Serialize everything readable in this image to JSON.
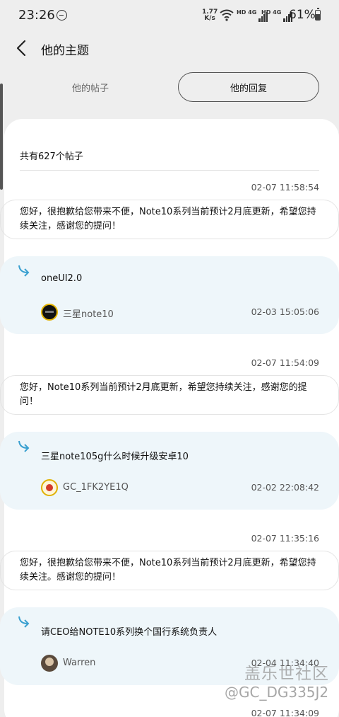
{
  "status_bar": {
    "time": "23:26",
    "net_speed_value": "1.77",
    "net_speed_unit": "K/s",
    "sim1_label": "HD 4G",
    "sim2_label": "HD 4G",
    "battery_percent": "61%",
    "battery_level": 0.61
  },
  "header": {
    "title": "他的主题"
  },
  "tabs": [
    {
      "label": "他的帖子",
      "selected": false
    },
    {
      "label": "他的回复",
      "selected": true
    }
  ],
  "list": {
    "count_text": "共有627个帖子",
    "items": [
      {
        "time": "02-07 11:58:54",
        "text": "您好，很抱歉给您带来不便，Note10系列当前预计2月底更新，希望您持续关注，感谢您的提问！",
        "quote": {
          "title": "oneUI2.0",
          "author": "三星note10",
          "time": "02-03 15:05:06"
        }
      },
      {
        "time": "02-07 11:54:09",
        "text": "您好，Note10系列当前预计2月底更新，希望您持续关注，感谢您的提问！",
        "quote": {
          "title": "三星note105g什么时候升级安卓10",
          "author": "GC_1FK2YE1Q",
          "time": "02-02 22:08:42"
        }
      },
      {
        "time": "02-07 11:35:16",
        "text": "您好，很抱歉给您带来不便，Note10系列当前预计2月底更新，希望您持续关注。感谢您的提问！",
        "quote": {
          "title": "请CEO给NOTE10系列换个国行系统负责人",
          "author": "Warren",
          "time": "02-04 11:34:40"
        }
      },
      {
        "time": "02-07 11:34:09"
      }
    ]
  },
  "watermark": {
    "brand": "盖乐世社区",
    "user": "@GC_DG335J2"
  }
}
